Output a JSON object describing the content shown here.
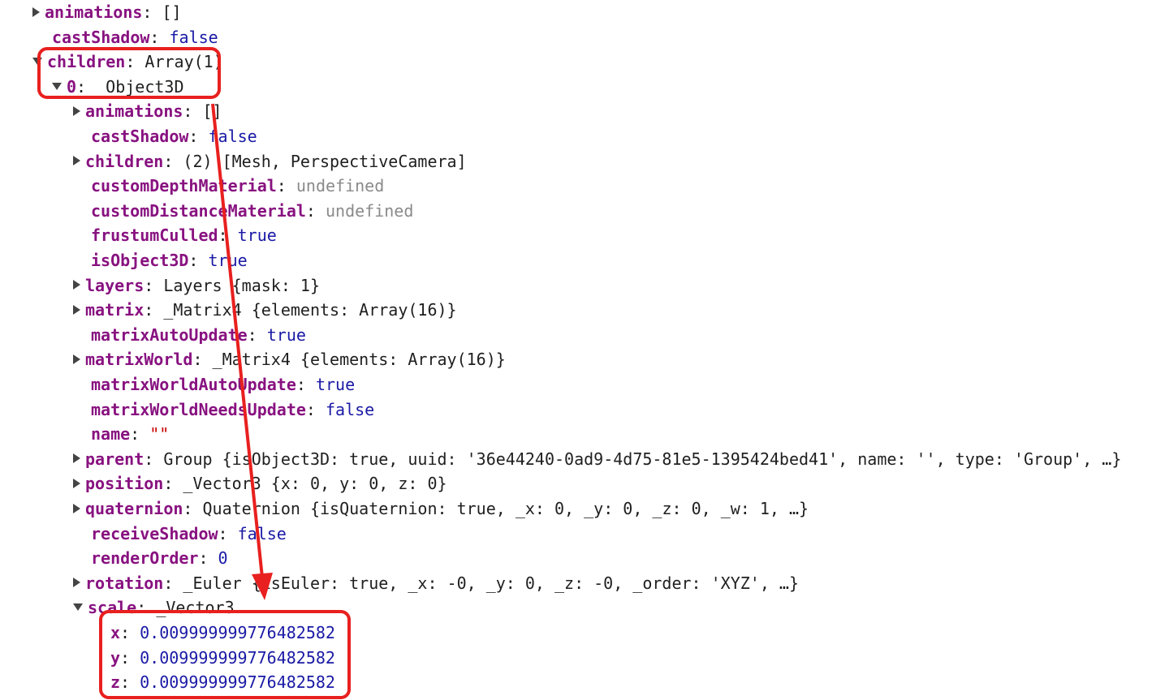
{
  "rows": [
    {
      "key": "animations",
      "value": "[]",
      "vclass": "val-dark",
      "tri": "right"
    },
    {
      "key": "castShadow",
      "value": "false",
      "vclass": "val-bool",
      "tri": "none"
    },
    {
      "key": "children",
      "value": "Array(1)",
      "vclass": "val-dark",
      "tri": "down"
    },
    {
      "key": "0",
      "value": "_Object3D",
      "vclass": "val-dark",
      "tri": "down"
    },
    {
      "key": "animations",
      "value": "[]",
      "vclass": "val-dark",
      "tri": "right"
    },
    {
      "key": "castShadow",
      "value": "false",
      "vclass": "val-bool",
      "tri": "none"
    },
    {
      "key": "children",
      "value": "(2) [Mesh, PerspectiveCamera]",
      "vclass": "val-dark",
      "tri": "right"
    },
    {
      "key": "customDepthMaterial",
      "value": "undefined",
      "vclass": "val-dim",
      "tri": "none"
    },
    {
      "key": "customDistanceMaterial",
      "value": "undefined",
      "vclass": "val-dim",
      "tri": "none"
    },
    {
      "key": "frustumCulled",
      "value": "true",
      "vclass": "val-bool",
      "tri": "none"
    },
    {
      "key": "isObject3D",
      "value": "true",
      "vclass": "val-bool",
      "tri": "none"
    },
    {
      "key": "layers",
      "value": "Layers {mask: 1}",
      "vclass": "val-dark",
      "tri": "right"
    },
    {
      "key": "matrix",
      "value": "_Matrix4 {elements: Array(16)}",
      "vclass": "val-dark",
      "tri": "right"
    },
    {
      "key": "matrixAutoUpdate",
      "value": "true",
      "vclass": "val-bool",
      "tri": "none"
    },
    {
      "key": "matrixWorld",
      "value": "_Matrix4 {elements: Array(16)}",
      "vclass": "val-dark",
      "tri": "right"
    },
    {
      "key": "matrixWorldAutoUpdate",
      "value": "true",
      "vclass": "val-bool",
      "tri": "none"
    },
    {
      "key": "matrixWorldNeedsUpdate",
      "value": "false",
      "vclass": "val-bool",
      "tri": "none"
    },
    {
      "key": "name",
      "value": "\"\"",
      "vclass": "val-str",
      "tri": "none"
    },
    {
      "key": "parent",
      "value": "Group {isObject3D: true, uuid: '36e44240-0ad9-4d75-81e5-1395424bed41', name: '', type: 'Group', …}",
      "vclass": "val-dark",
      "tri": "right"
    },
    {
      "key": "position",
      "value": "_Vector3 {x: 0, y: 0, z: 0}",
      "vclass": "val-dark",
      "tri": "right"
    },
    {
      "key": "quaternion",
      "value": "Quaternion {isQuaternion: true, _x: 0, _y: 0, _z: 0, _w: 1, …}",
      "vclass": "val-dark",
      "tri": "right"
    },
    {
      "key": "receiveShadow",
      "value": "false",
      "vclass": "val-bool",
      "tri": "none"
    },
    {
      "key": "renderOrder",
      "value": "0",
      "vclass": "val-num",
      "tri": "none"
    },
    {
      "key": "rotation",
      "value": "_Euler {isEuler: true, _x: -0, _y: 0, _z: -0, _order: 'XYZ', …}",
      "vclass": "val-dark",
      "tri": "right"
    },
    {
      "key": "scale",
      "value": "_Vector3",
      "vclass": "val-dark",
      "tri": "down"
    },
    {
      "key": "x",
      "value": "0.009999999776482582",
      "vclass": "val-num",
      "tri": "none"
    },
    {
      "key": "y",
      "value": "0.009999999776482582",
      "vclass": "val-num",
      "tri": "none"
    },
    {
      "key": "z",
      "value": "0.009999999776482582",
      "vclass": "val-num",
      "tri": "none"
    }
  ],
  "accent": "#e8201f"
}
